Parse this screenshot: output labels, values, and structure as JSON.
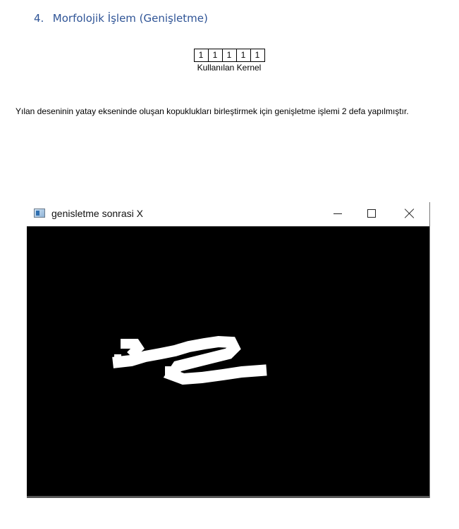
{
  "heading": {
    "number": "4.",
    "text": "Morfolojik İşlem (Genişletme)"
  },
  "kernel": {
    "values": [
      "1",
      "1",
      "1",
      "1",
      "1"
    ],
    "caption": "Kullanılan Kernel"
  },
  "paragraph": "Yılan deseninin yatay ekseninde oluşan kopuklukları birleştirmek için genişletme işlemi 2 defa yapılmıştır.",
  "window": {
    "title": "genisletme sonrasi X",
    "controls": {
      "minimize": "minimize-icon",
      "maximize": "maximize-icon",
      "close": "close-icon"
    }
  },
  "image": {
    "background": "#000000",
    "foreground": "#ffffff"
  }
}
